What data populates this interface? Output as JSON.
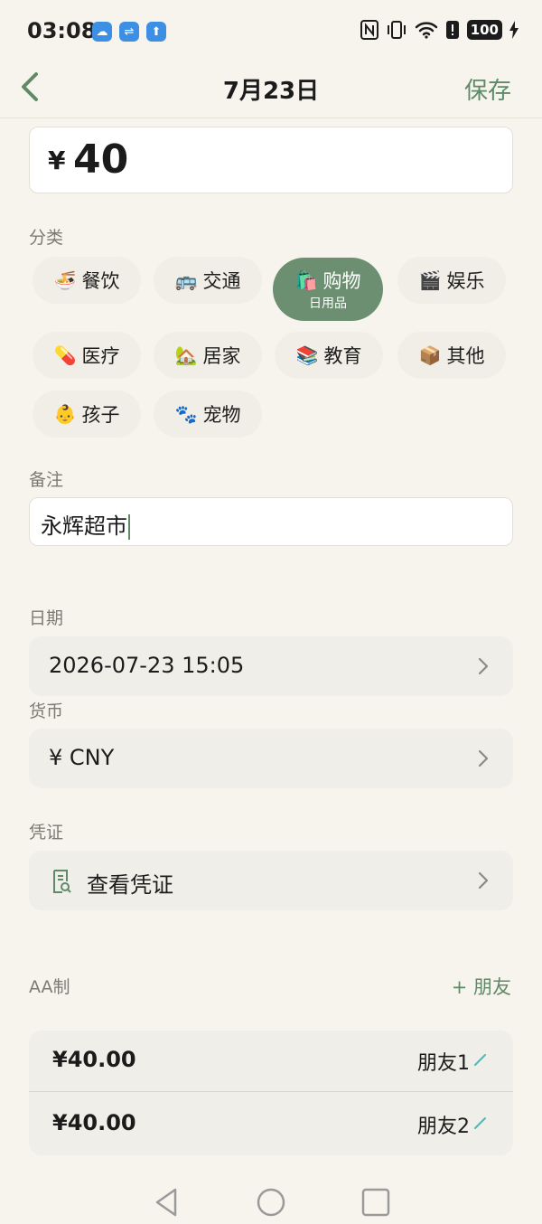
{
  "status_bar": {
    "time": "03:08",
    "left_icons": [
      "weather-icon",
      "usb-icon",
      "upload-icon"
    ],
    "right_icons": [
      "nfc-icon",
      "vibrate-icon",
      "wifi-icon",
      "alert-icon"
    ],
    "battery": "100"
  },
  "header": {
    "title": "7月23日",
    "save_label": "保存"
  },
  "amount": {
    "currency_symbol": "¥",
    "value": "40"
  },
  "category": {
    "label": "分类",
    "items": [
      {
        "emoji": "🍜",
        "label": "餐饮"
      },
      {
        "emoji": "🚌",
        "label": "交通"
      },
      {
        "emoji": "🛍️",
        "label": "购物",
        "sub": "日用品",
        "selected": true
      },
      {
        "emoji": "🎬",
        "label": "娱乐"
      },
      {
        "emoji": "💊",
        "label": "医疗"
      },
      {
        "emoji": "🏡",
        "label": "居家"
      },
      {
        "emoji": "📚",
        "label": "教育"
      },
      {
        "emoji": "📦",
        "label": "其他"
      },
      {
        "emoji": "👶",
        "label": "孩子"
      },
      {
        "emoji": "🐾",
        "label": "宠物"
      }
    ]
  },
  "note": {
    "label": "备注",
    "value": "永辉超市"
  },
  "date": {
    "label": "日期",
    "value": "2026-07-23  15:05"
  },
  "currency": {
    "label": "货币",
    "value": "¥  CNY"
  },
  "voucher": {
    "label": "凭证",
    "value": "查看凭证"
  },
  "split": {
    "label": "AA制",
    "add_label": "+ 朋友",
    "entries": [
      {
        "amount": "¥40.00",
        "name": "朋友1"
      },
      {
        "amount": "¥40.00",
        "name": "朋友2"
      }
    ]
  },
  "colors": {
    "accent": "#5f8a68",
    "selected_chip": "#6b8f70",
    "background": "#f7f4ee"
  }
}
